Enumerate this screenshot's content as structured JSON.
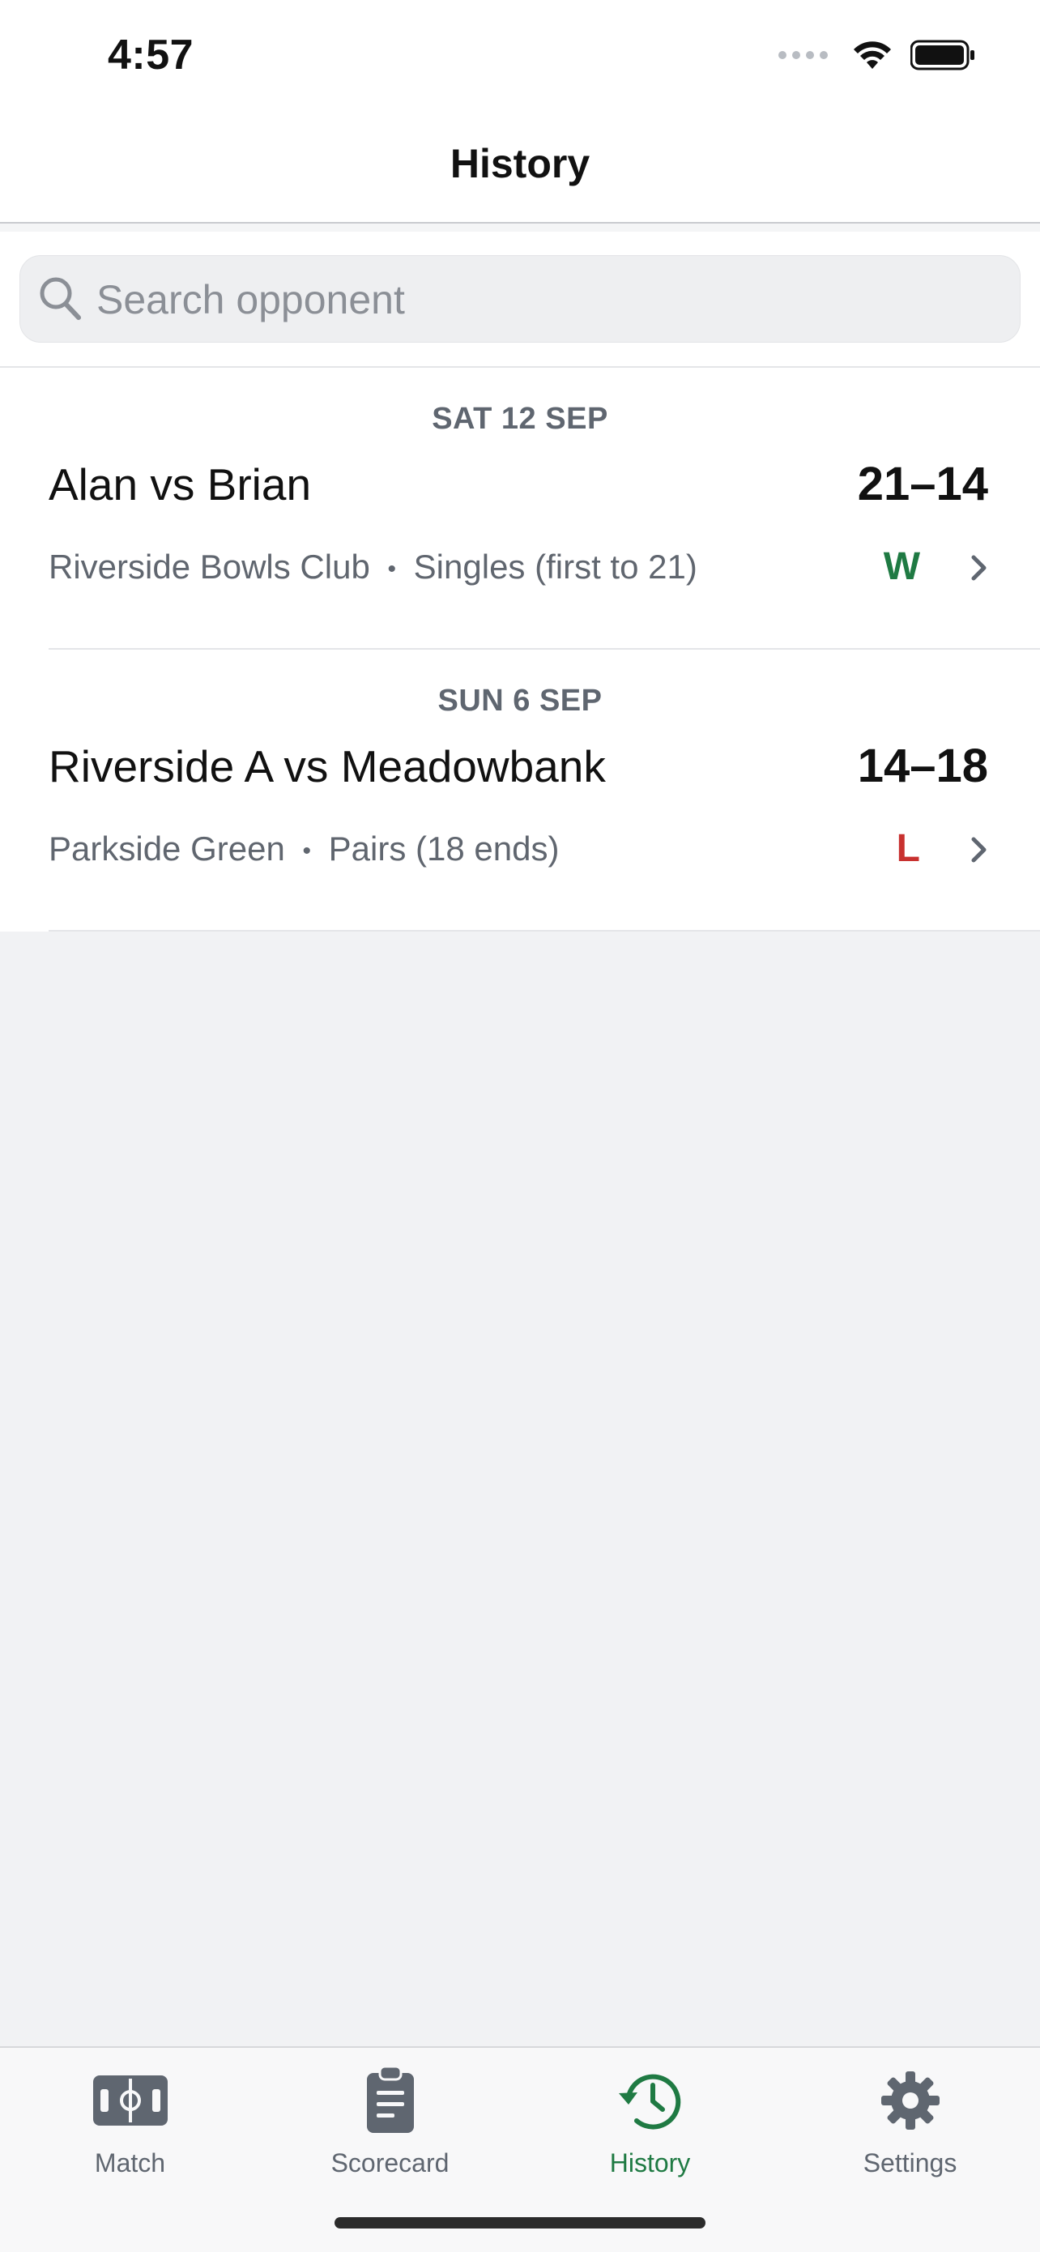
{
  "status_bar": {
    "time": "4:57"
  },
  "header": {
    "title": "History"
  },
  "search": {
    "placeholder": "Search opponent",
    "value": ""
  },
  "matches": [
    {
      "date": "SAT 12 SEP",
      "title": "Alan vs Brian",
      "score": "21–14",
      "venue": "Riverside Bowls Club",
      "format": "Singles (first to 21)",
      "separator": "•",
      "result": "W",
      "result_color": "#1f7a43"
    },
    {
      "date": "SUN 6 SEP",
      "title": "Riverside A vs Meadowbank",
      "score": "14–18",
      "venue": "Parkside Green",
      "format": "Pairs (18 ends)",
      "separator": "•",
      "result": "L",
      "result_color": "#c8312f"
    }
  ],
  "tabs": [
    {
      "label": "Match",
      "icon": "bowls-green-icon",
      "active": false
    },
    {
      "label": "Scorecard",
      "icon": "clipboard-icon",
      "active": false
    },
    {
      "label": "History",
      "icon": "history-clock-icon",
      "active": true
    },
    {
      "label": "Settings",
      "icon": "gear-icon",
      "active": false
    }
  ],
  "colors": {
    "accent": "#1f7a43",
    "win": "#1f7a43",
    "loss": "#c8312f",
    "inactive_tab": "#5f6670",
    "background": "#f1f2f4"
  }
}
